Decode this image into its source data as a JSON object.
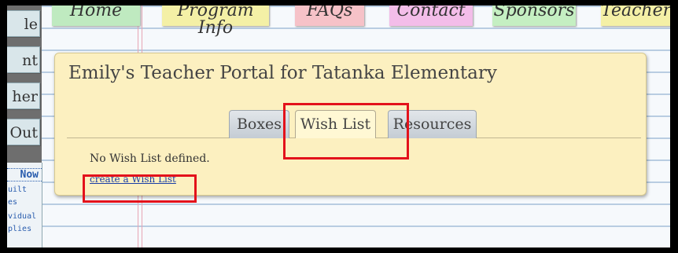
{
  "sidebar": {
    "items": [
      {
        "label": "le"
      },
      {
        "label": "nt"
      },
      {
        "label": "her"
      },
      {
        "label": "Out"
      }
    ],
    "promo": {
      "now": "Now",
      "line1": "uilt",
      "line2": "es",
      "line3": "vidual",
      "line4": "plies"
    }
  },
  "nav": {
    "tabs": [
      {
        "label": "Home"
      },
      {
        "label": "Program Info"
      },
      {
        "label": "FAQs"
      },
      {
        "label": "Contact"
      },
      {
        "label": "Sponsors"
      },
      {
        "label": "Teachers"
      }
    ]
  },
  "portal": {
    "title": "Emily's Teacher Portal for Tatanka Elementary",
    "tabs": [
      {
        "label": "Boxes"
      },
      {
        "label": "Wish List",
        "active": true
      },
      {
        "label": "Resources"
      }
    ],
    "message": "No Wish List defined.",
    "create_link": "create a Wish List"
  },
  "colors": {
    "panel_bg": "#fcf0c0",
    "highlight": "#e3121b",
    "link": "#1a3fa6"
  }
}
